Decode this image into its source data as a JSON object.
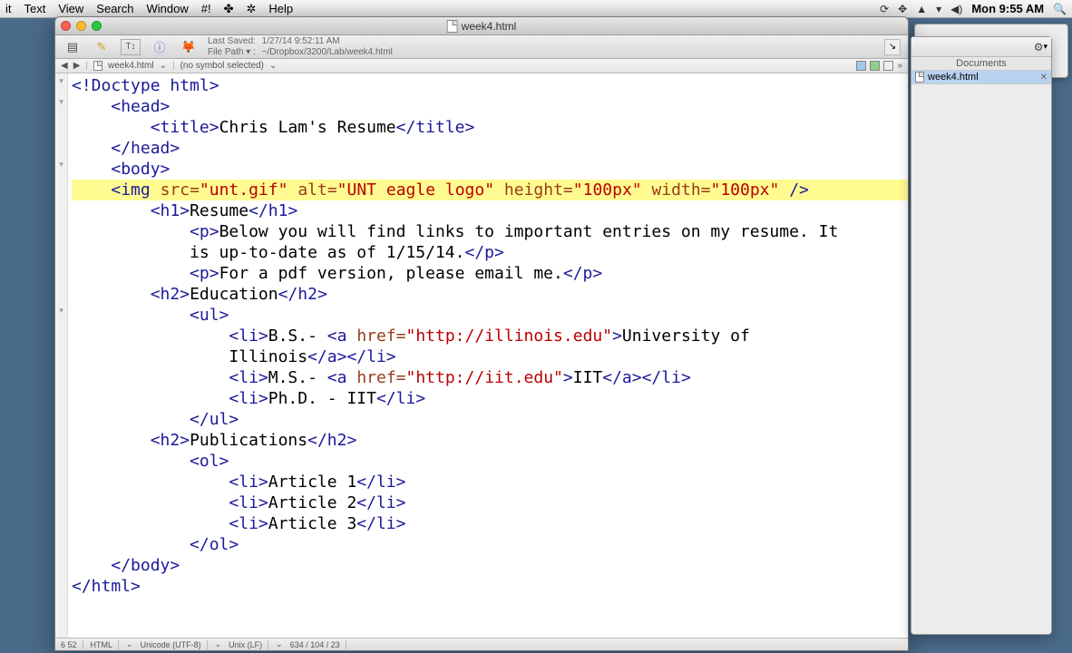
{
  "menubar": {
    "items": [
      "it",
      "Text",
      "View",
      "Search",
      "Window",
      "#!",
      "✤",
      "✲",
      "Help"
    ],
    "clock": "Mon 9:55 AM"
  },
  "window": {
    "title": "week4.html",
    "saved_label": "Last Saved:",
    "saved_value": "1/27/14 9:52:11 AM",
    "path_label": "File Path ▾ :",
    "path_value": "~/Dropbox/3200/Lab/week4.html",
    "nav_file": "week4.html",
    "nav_symbol": "(no symbol selected)"
  },
  "code": {
    "l1": "<!Doctype html>",
    "l2": "    <head>",
    "l3": "        <title>Chris Lam's Resume</title>",
    "l4": "    </head>",
    "l5": "    <body>",
    "l6": "    <img src=\"unt.gif\" alt=\"UNT eagle logo\" height=\"100px\" width=\"100px\" />",
    "l7": "        <h1>Resume</h1>",
    "l8": "            <p>Below you will find links to important entries on my resume. It",
    "l8b": "            is up-to-date as of 1/15/14.</p>",
    "l9": "            <p>For a pdf version, please email me.</p>",
    "l10": "        <h2>Education</h2>",
    "l11": "            <ul>",
    "l12": "                <li>B.S.- <a href=\"http://illinois.edu\">University of",
    "l12b": "                Illinois</a></li>",
    "l13": "                <li>M.S.- <a href=\"http://iit.edu\">IIT</a></li>",
    "l14": "                <li>Ph.D. - IIT</li>",
    "l15": "            </ul>",
    "l16": "        <h2>Publications</h2>",
    "l17": "            <ol>",
    "l18": "                <li>Article 1</li>",
    "l19": "                <li>Article 2</li>",
    "l20": "                <li>Article 3</li>",
    "l21": "            </ol>",
    "l22": "    </body>",
    "l23": "</html>"
  },
  "status": {
    "pos": "6  52",
    "lang": "HTML",
    "enc": "Unicode (UTF-8)",
    "lineend": "Unix (LF)",
    "extra": "634 / 104 / 23"
  },
  "drawer": {
    "title": "Documents",
    "item": "week4.html"
  }
}
